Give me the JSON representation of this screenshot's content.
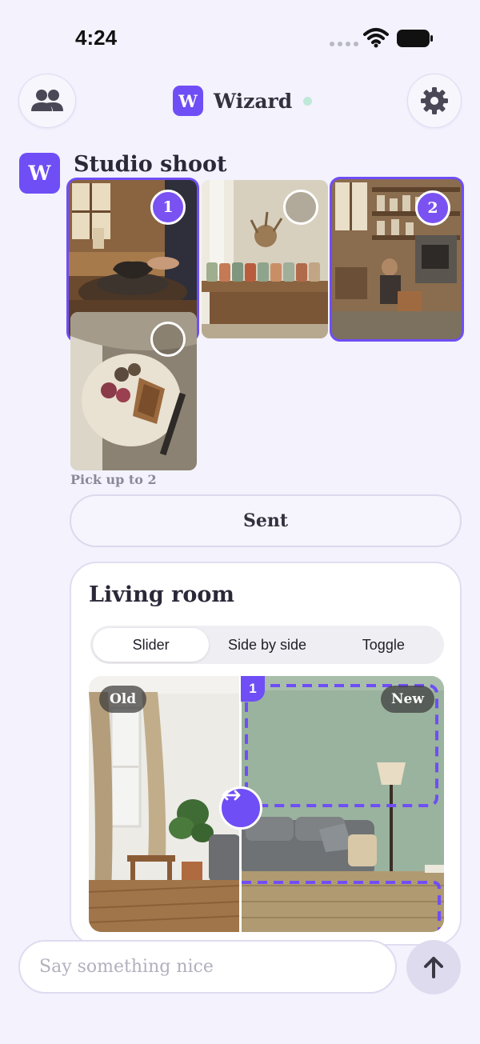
{
  "status_bar": {
    "time": "4:24"
  },
  "header": {
    "app_initial": "W",
    "title": "Wizard",
    "people_icon": "people-icon",
    "settings_icon": "gear-icon",
    "online_color": "#bfe8d8"
  },
  "message": {
    "avatar_initial": "W",
    "title": "Studio shoot",
    "photos": [
      {
        "subject": "potter at wheel",
        "selected": true,
        "order": "1"
      },
      {
        "subject": "mugs on shelf",
        "selected": false,
        "order": ""
      },
      {
        "subject": "pottery workshop",
        "selected": true,
        "order": "2"
      },
      {
        "subject": "figs and bread plate",
        "selected": false,
        "order": ""
      }
    ],
    "hint": "Pick up to 2",
    "sent_label": "Sent"
  },
  "card": {
    "title": "Living room",
    "tabs": [
      {
        "label": "Slider",
        "active": true
      },
      {
        "label": "Side by side",
        "active": false
      },
      {
        "label": "Toggle",
        "active": false
      }
    ],
    "old_label": "Old",
    "new_label": "New",
    "region_number": "1",
    "handle_icon": "left-right-arrows-icon"
  },
  "composer": {
    "placeholder": "Say something nice",
    "send_icon": "arrow-up-icon"
  },
  "colors": {
    "accent": "#6f4ef6",
    "background": "#f3f2fd"
  }
}
